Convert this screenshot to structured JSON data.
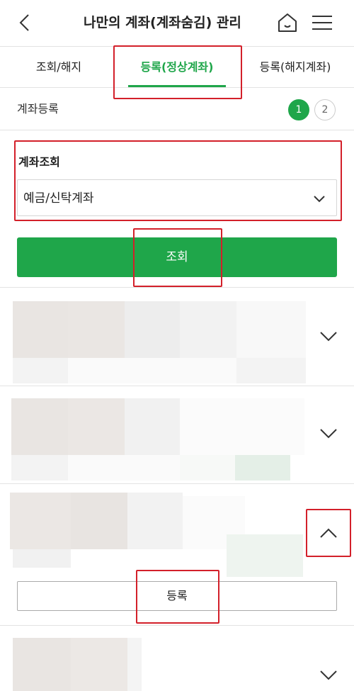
{
  "header": {
    "title": "나만의 계좌(계좌숨김) 관리",
    "back_icon": "chevron-left-icon",
    "home_icon": "home-icon",
    "menu_icon": "hamburger-menu-icon"
  },
  "tabs": [
    {
      "label": "조회/해지",
      "active": false
    },
    {
      "label": "등록(정상계좌)",
      "active": true
    },
    {
      "label": "등록(해지계좌)",
      "active": false
    }
  ],
  "step": {
    "title": "계좌등록",
    "steps": [
      "1",
      "2"
    ],
    "current": 1
  },
  "account_query": {
    "label": "계좌조회",
    "selected": "예금/신탁계좌",
    "search_label": "조회"
  },
  "accounts": [
    {
      "expanded": false
    },
    {
      "expanded": false
    },
    {
      "expanded": true,
      "register_label": "등록"
    },
    {
      "expanded": false
    }
  ],
  "colors": {
    "accent": "#1fa64a",
    "highlight": "#d3202a"
  }
}
